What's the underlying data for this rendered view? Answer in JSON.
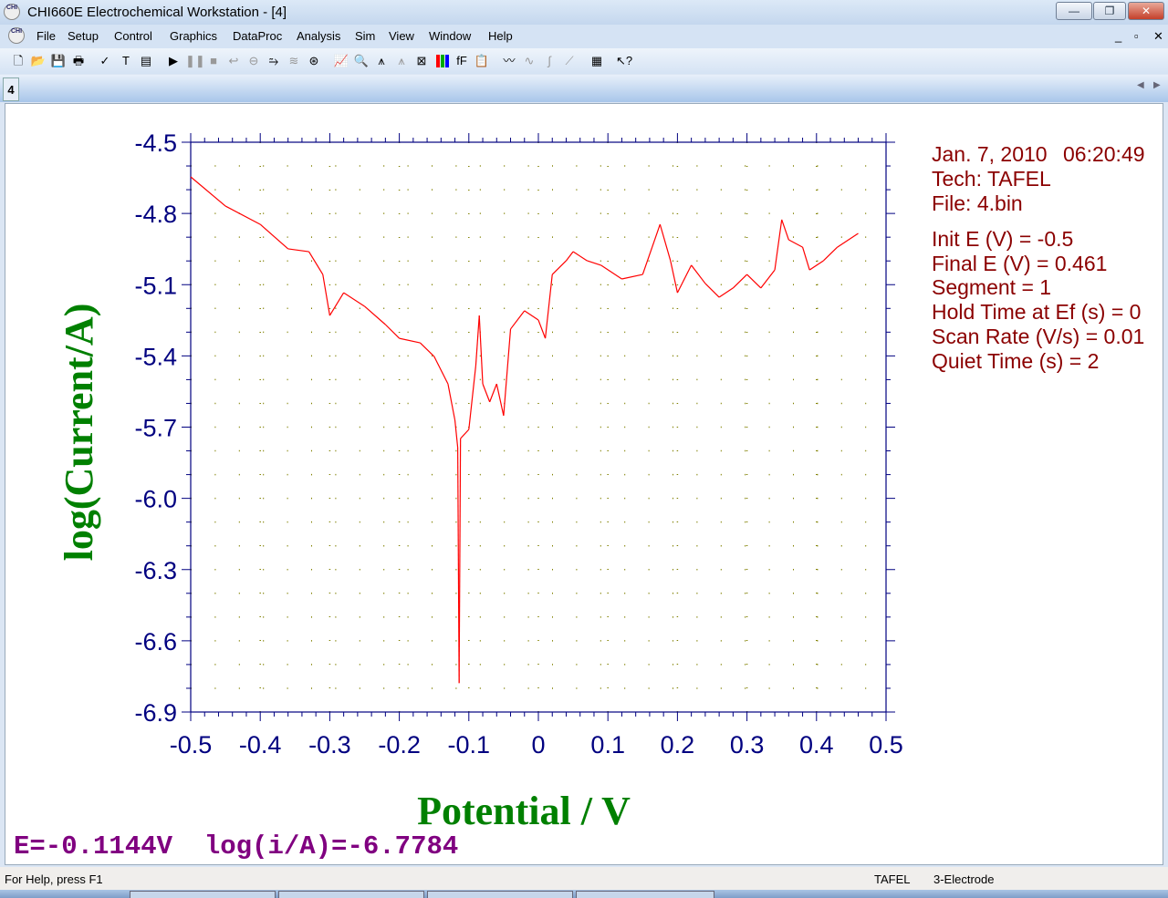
{
  "window": {
    "title": "CHI660E Electrochemical Workstation - [4]",
    "icon_text": "CHI",
    "minimize": "—",
    "restore": "❐",
    "close": "✕"
  },
  "menu": [
    "File",
    "Setup",
    "Control",
    "Graphics",
    "DataProc",
    "Analysis",
    "Sim",
    "View",
    "Window",
    "Help"
  ],
  "mdi_controls": [
    "_",
    "▫",
    "✕"
  ],
  "toolbar": [
    {
      "name": "new-icon",
      "g": "🗋",
      "dis": false
    },
    {
      "name": "open-icon",
      "g": "📂",
      "dis": false
    },
    {
      "name": "save-icon",
      "g": "💾",
      "dis": false
    },
    {
      "name": "print-icon",
      "g": "🖶",
      "dis": false
    },
    {
      "name": "system-icon",
      "g": "✓",
      "dis": false
    },
    {
      "name": "technique-icon",
      "g": "T",
      "dis": false
    },
    {
      "name": "parameters-icon",
      "g": "▤",
      "dis": false
    },
    {
      "name": "run-icon",
      "g": "▶",
      "dis": false
    },
    {
      "name": "pause-icon",
      "g": "❚❚",
      "dis": true
    },
    {
      "name": "stop-icon",
      "g": "■",
      "dis": true
    },
    {
      "name": "reverse-icon",
      "g": "↩",
      "dis": true
    },
    {
      "name": "ir-comp-icon",
      "g": "⊖",
      "dis": true
    },
    {
      "name": "filter-icon",
      "g": "⥲",
      "dis": false
    },
    {
      "name": "cell-icon",
      "g": "≋",
      "dis": true
    },
    {
      "name": "rotator-icon",
      "g": "⊛",
      "dis": false
    },
    {
      "name": "graph-icon",
      "g": "📈",
      "dis": false
    },
    {
      "name": "zoom-icon",
      "g": "🔍",
      "dis": false
    },
    {
      "name": "peak-icon",
      "g": "⩚",
      "dis": false
    },
    {
      "name": "overlay-icon",
      "g": "⩚",
      "dis": true
    },
    {
      "name": "device-icon",
      "g": "⊠",
      "dis": false
    },
    {
      "name": "color-icon",
      "g": "▮▮▮",
      "dis": false
    },
    {
      "name": "font-icon",
      "g": "fF",
      "dis": false
    },
    {
      "name": "clipboard-icon",
      "g": "📋",
      "dis": false
    },
    {
      "name": "smooth-icon",
      "g": "〰",
      "dis": false
    },
    {
      "name": "derivative-icon",
      "g": "∿",
      "dis": true
    },
    {
      "name": "integral-icon",
      "g": "∫",
      "dis": true
    },
    {
      "name": "fit-icon",
      "g": "⟋",
      "dis": true
    },
    {
      "name": "text-report-icon",
      "g": "▦",
      "dis": false
    },
    {
      "name": "context-help-icon",
      "g": "↖?",
      "dis": false
    }
  ],
  "tabs": [
    {
      "label": "4"
    }
  ],
  "info": {
    "date": "Jan. 7, 2010",
    "time": "06:20:49",
    "tech": "Tech: TAFEL",
    "file": "File: 4.bin",
    "params": [
      "Init E (V) = -0.5",
      "Final E (V) = 0.461",
      "Segment = 1",
      "Hold Time at Ef (s) = 0",
      "Scan Rate (V/s) = 0.01",
      "Quiet Time (s) = 2"
    ]
  },
  "cursor_readout": "E=-0.1144V  log(i/A)=-6.7784",
  "status": {
    "help": "For Help, press F1",
    "technique": "TAFEL",
    "electrode": "3-Electrode"
  },
  "colors": {
    "curve": "#ff0000",
    "axis": "#000080",
    "label": "#008000",
    "info": "#8b0000",
    "readout": "#800080"
  },
  "chart_data": {
    "type": "line",
    "xlabel": "Potential / V",
    "ylabel": "log(Current/A)",
    "xlim": [
      -0.5,
      0.5
    ],
    "ylim": [
      -6.9,
      -4.5
    ],
    "xticks": [
      "-0.5",
      "-0.4",
      "-0.3",
      "-0.2",
      "-0.1",
      "0",
      "0.1",
      "0.2",
      "0.3",
      "0.4",
      "0.5"
    ],
    "yticks": [
      "-4.5",
      "-4.8",
      "-5.1",
      "-5.4",
      "-5.7",
      "-6.0",
      "-6.3",
      "-6.6",
      "-6.9"
    ],
    "grid": true,
    "x": [
      -0.5,
      -0.45,
      -0.4,
      -0.36,
      -0.33,
      -0.31,
      -0.3,
      -0.28,
      -0.25,
      -0.22,
      -0.2,
      -0.17,
      -0.15,
      -0.13,
      -0.12,
      -0.116,
      -0.114,
      -0.112,
      -0.1,
      -0.09,
      -0.085,
      -0.08,
      -0.07,
      -0.06,
      -0.05,
      -0.04,
      -0.02,
      0,
      0.01,
      0.02,
      0.04,
      0.05,
      0.07,
      0.09,
      0.12,
      0.15,
      0.175,
      0.19,
      0.2,
      0.22,
      0.24,
      0.26,
      0.28,
      0.3,
      0.32,
      0.34,
      0.35,
      0.36,
      0.38,
      0.39,
      0.41,
      0.43,
      0.46
    ],
    "y": [
      -4.646,
      -4.769,
      -4.846,
      -4.949,
      -4.961,
      -5.057,
      -5.23,
      -5.134,
      -5.191,
      -5.268,
      -5.326,
      -5.345,
      -5.402,
      -5.518,
      -5.671,
      -5.786,
      -6.778,
      -5.748,
      -5.71,
      -5.441,
      -5.23,
      -5.518,
      -5.594,
      -5.518,
      -5.652,
      -5.287,
      -5.21,
      -5.249,
      -5.326,
      -5.057,
      -4.999,
      -4.961,
      -4.999,
      -5.018,
      -5.076,
      -5.057,
      -4.846,
      -4.999,
      -5.134,
      -5.018,
      -5.095,
      -5.153,
      -5.114,
      -5.057,
      -5.114,
      -5.038,
      -4.826,
      -4.911,
      -4.942,
      -5.038,
      -4.999,
      -4.942,
      -4.884
    ]
  }
}
